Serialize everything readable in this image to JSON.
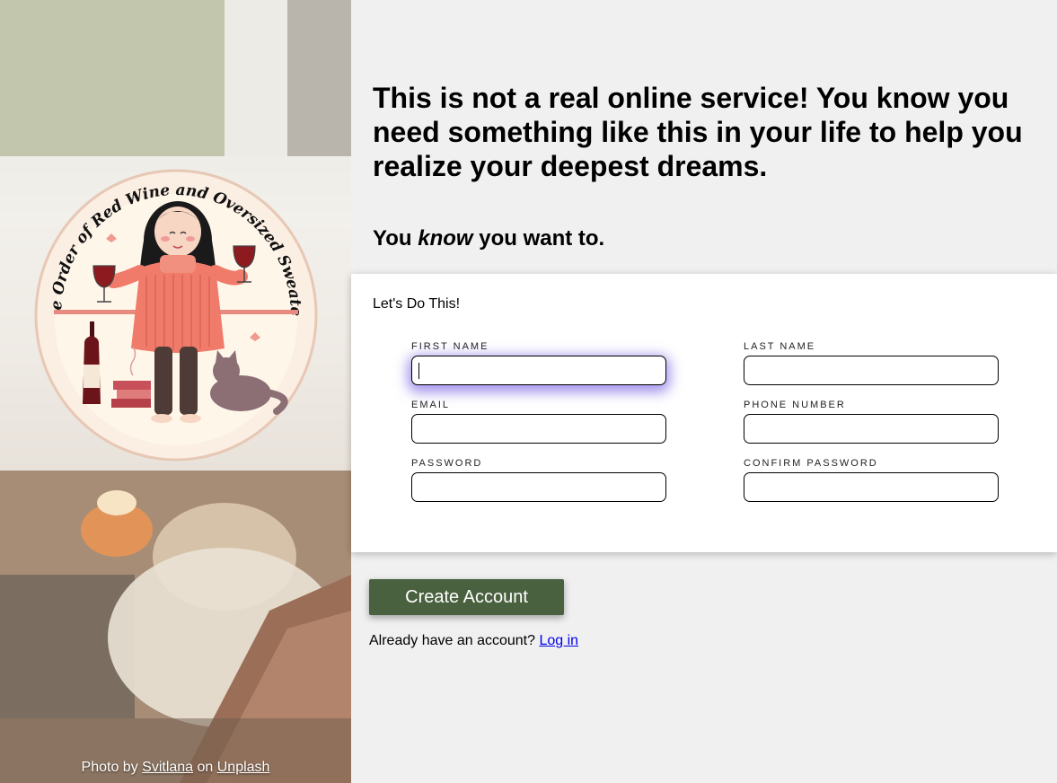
{
  "headline": "This is not a real online service! You know you need something like this in your life to help you realize your deepest dreams.",
  "subhead": {
    "before": "You ",
    "emphasis": "know",
    "after": " you want to."
  },
  "logo": {
    "ring_text": "The Order of Red Wine and Oversized Sweaters"
  },
  "form": {
    "title": "Let's Do This!",
    "fields": {
      "first_name": {
        "label": "FIRST NAME",
        "value": ""
      },
      "last_name": {
        "label": "LAST NAME",
        "value": ""
      },
      "email": {
        "label": "EMAIL",
        "value": ""
      },
      "phone": {
        "label": "PHONE NUMBER",
        "value": ""
      },
      "password": {
        "label": "PASSWORD",
        "value": ""
      },
      "confirm_password": {
        "label": "CONFIRM PASSWORD",
        "value": ""
      }
    }
  },
  "actions": {
    "create_label": "Create Account",
    "login_prompt": "Already have an account? ",
    "login_link": "Log in"
  },
  "credit": {
    "prefix": "Photo by ",
    "author": "Svitlana",
    "middle": " on ",
    "site": "Unplash"
  },
  "colors": {
    "button": "#4a6140",
    "focus_glow": "#5a3cdc",
    "link": "#0000ee"
  }
}
